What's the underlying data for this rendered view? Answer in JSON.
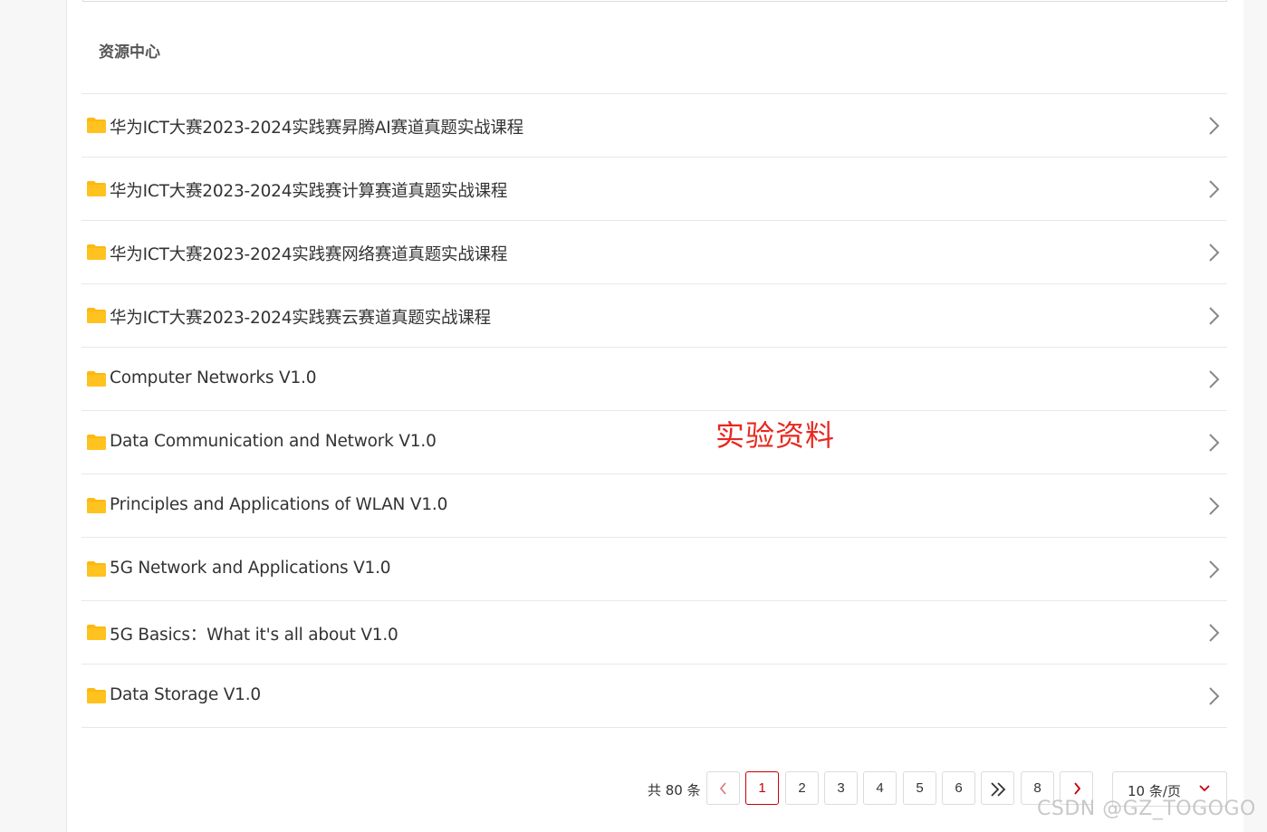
{
  "section": {
    "title": "资源中心"
  },
  "items": [
    {
      "label": "华为ICT大赛2023-2024实践赛昇腾AI赛道真题实战课程"
    },
    {
      "label": "华为ICT大赛2023-2024实践赛计算赛道真题实战课程"
    },
    {
      "label": "华为ICT大赛2023-2024实践赛网络赛道真题实战课程"
    },
    {
      "label": "华为ICT大赛2023-2024实践赛云赛道真题实战课程"
    },
    {
      "label": "Computer Networks V1.0"
    },
    {
      "label": "Data Communication and Network V1.0"
    },
    {
      "label": "Principles and Applications of WLAN V1.0"
    },
    {
      "label": "5G Network and Applications V1.0"
    },
    {
      "label": "5G Basics：What it's all about V1.0"
    },
    {
      "label": "Data Storage V1.0"
    }
  ],
  "annotation": {
    "text": "实验资料",
    "color": "#e8281e"
  },
  "pagination": {
    "total": "共 80 条",
    "pages": [
      "1",
      "2",
      "3",
      "4",
      "5",
      "6",
      "8"
    ],
    "current": "1",
    "page_size": "10 条/页"
  },
  "watermark": "CSDN @GZ_TOGOGO",
  "colors": {
    "accent": "#c7000b",
    "folder": "#fdb813"
  },
  "icons": {
    "folder": "folder-icon",
    "chevron": "chevron-right-icon",
    "prev": "chevron-left-icon",
    "next": "chevron-right-icon",
    "jump": "double-chevron-right-icon",
    "caret": "chevron-down-icon"
  }
}
